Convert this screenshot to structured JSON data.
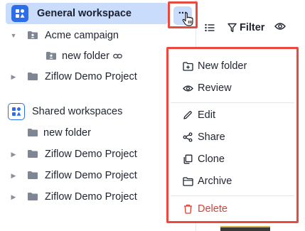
{
  "sidebar": {
    "general": {
      "label": "General workspace"
    },
    "acme": {
      "label": "Acme campaign"
    },
    "acme_sub": {
      "label": "new folder"
    },
    "ziflow1": {
      "label": "Ziflow Demo Project"
    },
    "shared": {
      "label": "Shared workspaces"
    },
    "shared_items": [
      {
        "label": "new folder"
      },
      {
        "label": "Ziflow Demo Project"
      },
      {
        "label": "Ziflow Demo Project"
      },
      {
        "label": "Ziflow Demo Project"
      }
    ],
    "more_label": "..."
  },
  "toolbar": {
    "filter_label": "Filter"
  },
  "context_menu": {
    "items": [
      {
        "label": "New folder",
        "icon": "folder-plus-icon"
      },
      {
        "label": "Review",
        "icon": "eye-icon"
      },
      {
        "label": "Edit",
        "icon": "pencil-icon"
      },
      {
        "label": "Share",
        "icon": "share-icon"
      },
      {
        "label": "Clone",
        "icon": "clone-icon"
      },
      {
        "label": "Archive",
        "icon": "archive-icon"
      },
      {
        "label": "Delete",
        "icon": "trash-icon"
      }
    ]
  },
  "colors": {
    "accent": "#2c6ee8",
    "selected_bg": "#c9dcfb",
    "highlight_border": "#e84a3f",
    "danger": "#d64235",
    "folder": "#7e8593"
  }
}
